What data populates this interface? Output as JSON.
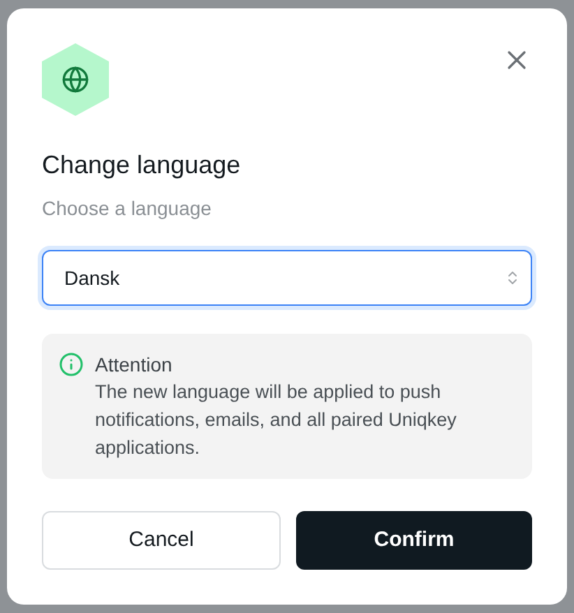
{
  "dialog": {
    "title": "Change language",
    "subtitle": "Choose a language",
    "select": {
      "value": "Dansk",
      "focused": true
    },
    "notice": {
      "title": "Attention",
      "text": "The new language will be applied to push notifications, emails, and all paired Uniqkey applications."
    },
    "buttons": [
      {
        "label": "Cancel",
        "kind": "secondary"
      },
      {
        "label": "Confirm",
        "kind": "primary"
      }
    ]
  }
}
